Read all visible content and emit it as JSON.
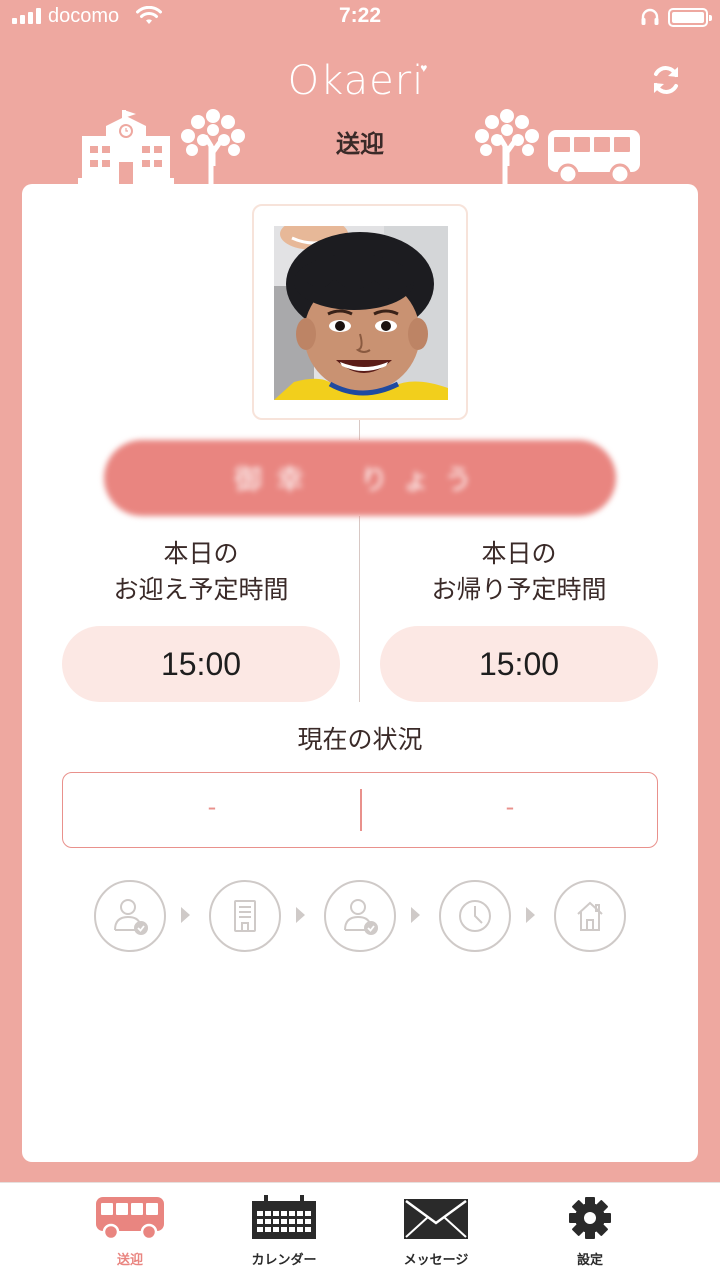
{
  "status_bar": {
    "carrier": "docomo",
    "time": "7:22"
  },
  "header": {
    "logo": "Okaeri",
    "title": "送迎"
  },
  "child": {
    "name": "御幸　りょう"
  },
  "pickup": {
    "label_line1": "本日の",
    "label_line2": "お迎え予定時間",
    "time": "15:00"
  },
  "return": {
    "label_line1": "本日の",
    "label_line2": "お帰り予定時間",
    "time": "15:00"
  },
  "current_status": {
    "title": "現在の状況",
    "left_value": "-",
    "right_value": "-"
  },
  "progress_steps": [
    {
      "icon": "person-check-icon"
    },
    {
      "icon": "building-icon"
    },
    {
      "icon": "person-check-icon"
    },
    {
      "icon": "clock-icon"
    },
    {
      "icon": "house-icon"
    }
  ],
  "tabs": [
    {
      "label": "送迎",
      "icon": "bus-icon",
      "active": true
    },
    {
      "label": "カレンダー",
      "icon": "calendar-icon",
      "active": false
    },
    {
      "label": "メッセージ",
      "icon": "envelope-icon",
      "active": false
    },
    {
      "label": "設定",
      "icon": "gear-icon",
      "active": false
    }
  ],
  "colors": {
    "background": "#eea8a0",
    "accent": "#e98580",
    "pill_light": "#fce8e4",
    "step_gray": "#cfcac8"
  }
}
